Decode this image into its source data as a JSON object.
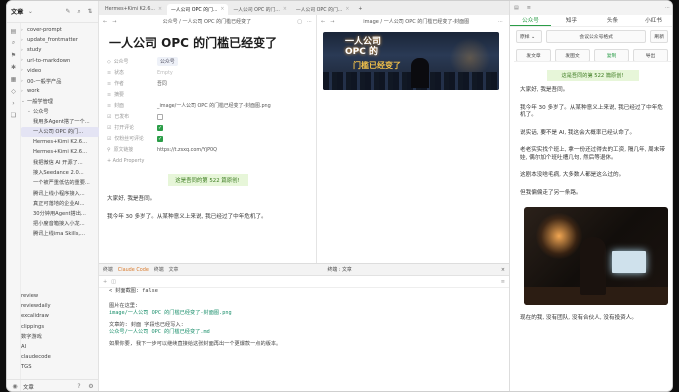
{
  "sidebar": {
    "title": "文章",
    "tree": [
      {
        "label": "cover-prompt",
        "badge": ""
      },
      {
        "label": "update_frontmatter",
        "badge": ""
      },
      {
        "label": "study",
        "badge": ""
      },
      {
        "label": "url-to-markdown",
        "badge": ""
      },
      {
        "label": "video",
        "badge": ""
      },
      {
        "label": "00-一般学产品",
        "badge": ""
      },
      {
        "label": "work",
        "badge": ""
      },
      {
        "label": "一般学管理",
        "badge": ""
      },
      {
        "label": "公众号",
        "badge": ""
      },
      {
        "label": "我用多Agent搭了一个...",
        "badge": ""
      },
      {
        "label": "一人公司 OPC 的门...",
        "badge": ""
      },
      {
        "label": "Hermes+Kimi K2.6...",
        "badge": ""
      },
      {
        "label": "Hermes+Kimi K2.6...",
        "badge": ""
      },
      {
        "label": "我把微信 AI 开源了...",
        "badge": ""
      },
      {
        "label": "接入Seedance 2.0...",
        "badge": ""
      },
      {
        "label": "一个被严重低估的重要...",
        "badge": ""
      },
      {
        "label": "腾讯上线小程序接入...",
        "badge": ""
      },
      {
        "label": "真正可落地的企业AI...",
        "badge": ""
      },
      {
        "label": "30分钟用Agent搭出...",
        "badge": ""
      },
      {
        "label": "把小度音箱接入小龙...",
        "badge": ""
      },
      {
        "label": "腾讯上线ima Skills,...",
        "badge": ""
      }
    ],
    "lower": [
      "review",
      "reviewdaily",
      "excalidraw",
      "clippings",
      "数字游戏",
      "AI",
      "claudecode",
      "TGS"
    ],
    "footer_label": "文章"
  },
  "tabs": [
    {
      "label": "Hermes+Kimi K2.6..."
    },
    {
      "label": "一人公司 OPC 的门..."
    },
    {
      "label": "一人公司 OPC 的门..."
    },
    {
      "label": "一人公司 OPC 的门..."
    }
  ],
  "editor": {
    "breadcrumb": "公众号 / 一人公司 OPC 的门槛已经变了",
    "title": "一人公司 OPC 的门槛已经变了",
    "props": [
      {
        "key": "公众号",
        "value": "公众号",
        "style": "tag"
      },
      {
        "key": "状态",
        "value": "Empty",
        "style": "ph"
      },
      {
        "key": "作者",
        "value": "吾同",
        "style": ""
      },
      {
        "key": "摘要",
        "value": "",
        "style": "ph"
      },
      {
        "key": "封面",
        "value": "_image/一人公司 OPC 的门槛已经变了-封面图.png",
        "style": ""
      },
      {
        "key": "已发布",
        "value": "",
        "style": "cb"
      },
      {
        "key": "打开评论",
        "value": "",
        "style": "cbon"
      },
      {
        "key": "仅粉丝可评论",
        "value": "",
        "style": "cbon"
      },
      {
        "key": "原文链接",
        "value": "https://t.zsxq.com/YjP0Q",
        "style": ""
      },
      {
        "key": "+ Add Property",
        "value": "",
        "style": "ph"
      }
    ],
    "highlight": "这是吾同的第 522 篇原创!",
    "p1": "大家好, 我是吾同。",
    "p2": "我今年 30 多岁了。从某种意义上来说, 我已经过了中年危机了。"
  },
  "editor2": {
    "breadcrumb": "image / 一人公司 OPC 的门槛已经变了-封面图",
    "cover_line1": "一人公司",
    "cover_line2": "OPC 的",
    "cover_line3": "门槛已经变了"
  },
  "terminal": {
    "tabs": [
      "终端",
      "Claude Code",
      "终端",
      "文章"
    ],
    "title": "终端 : 文章",
    "lines": [
      "< 封面截图: false",
      "",
      "图片在这里:",
      "image/一人公司 OPC 的门槛已经变了-封面图.png",
      "",
      "文章的: 封面 字段也已经写入:",
      "公众号/一人公司 OPC 的门槛已经变了.md",
      "",
      "如果你要, 我下一步可以继续直接给这张封面再出一个更爆款一点的版本。"
    ]
  },
  "right": {
    "top": [
      "终端 : 文章"
    ],
    "tabs": [
      "公众号",
      "知乎",
      "头条",
      "小红书"
    ],
    "row1": {
      "select": "原样",
      "btn1": "会议公众号格式",
      "btn2": "刷新"
    },
    "row2": [
      "发文章",
      "发图文",
      "复制",
      "导出"
    ],
    "highlight": "这是吾同的第 522 篇原创!",
    "paras": [
      "大家好, 我是吾同。",
      "我今年 30 多岁了。从某种意义上来说, 我已经过了中年危机了。",
      "说实话, 要不是 AI, 我这会大概率已经认命了。",
      "老老实实找个班上, 拿一份还过得去的工资, 隔几年, 周末带娃, 偶尔加个班吐槽几句, 然后等退休。",
      "这剧本没啥毛病, 大多数人都是这么过的。",
      "但我偏偏走了另一条路。"
    ],
    "after_img": "现在的我, 没有团队, 没有合伙人, 没有投资人。"
  }
}
